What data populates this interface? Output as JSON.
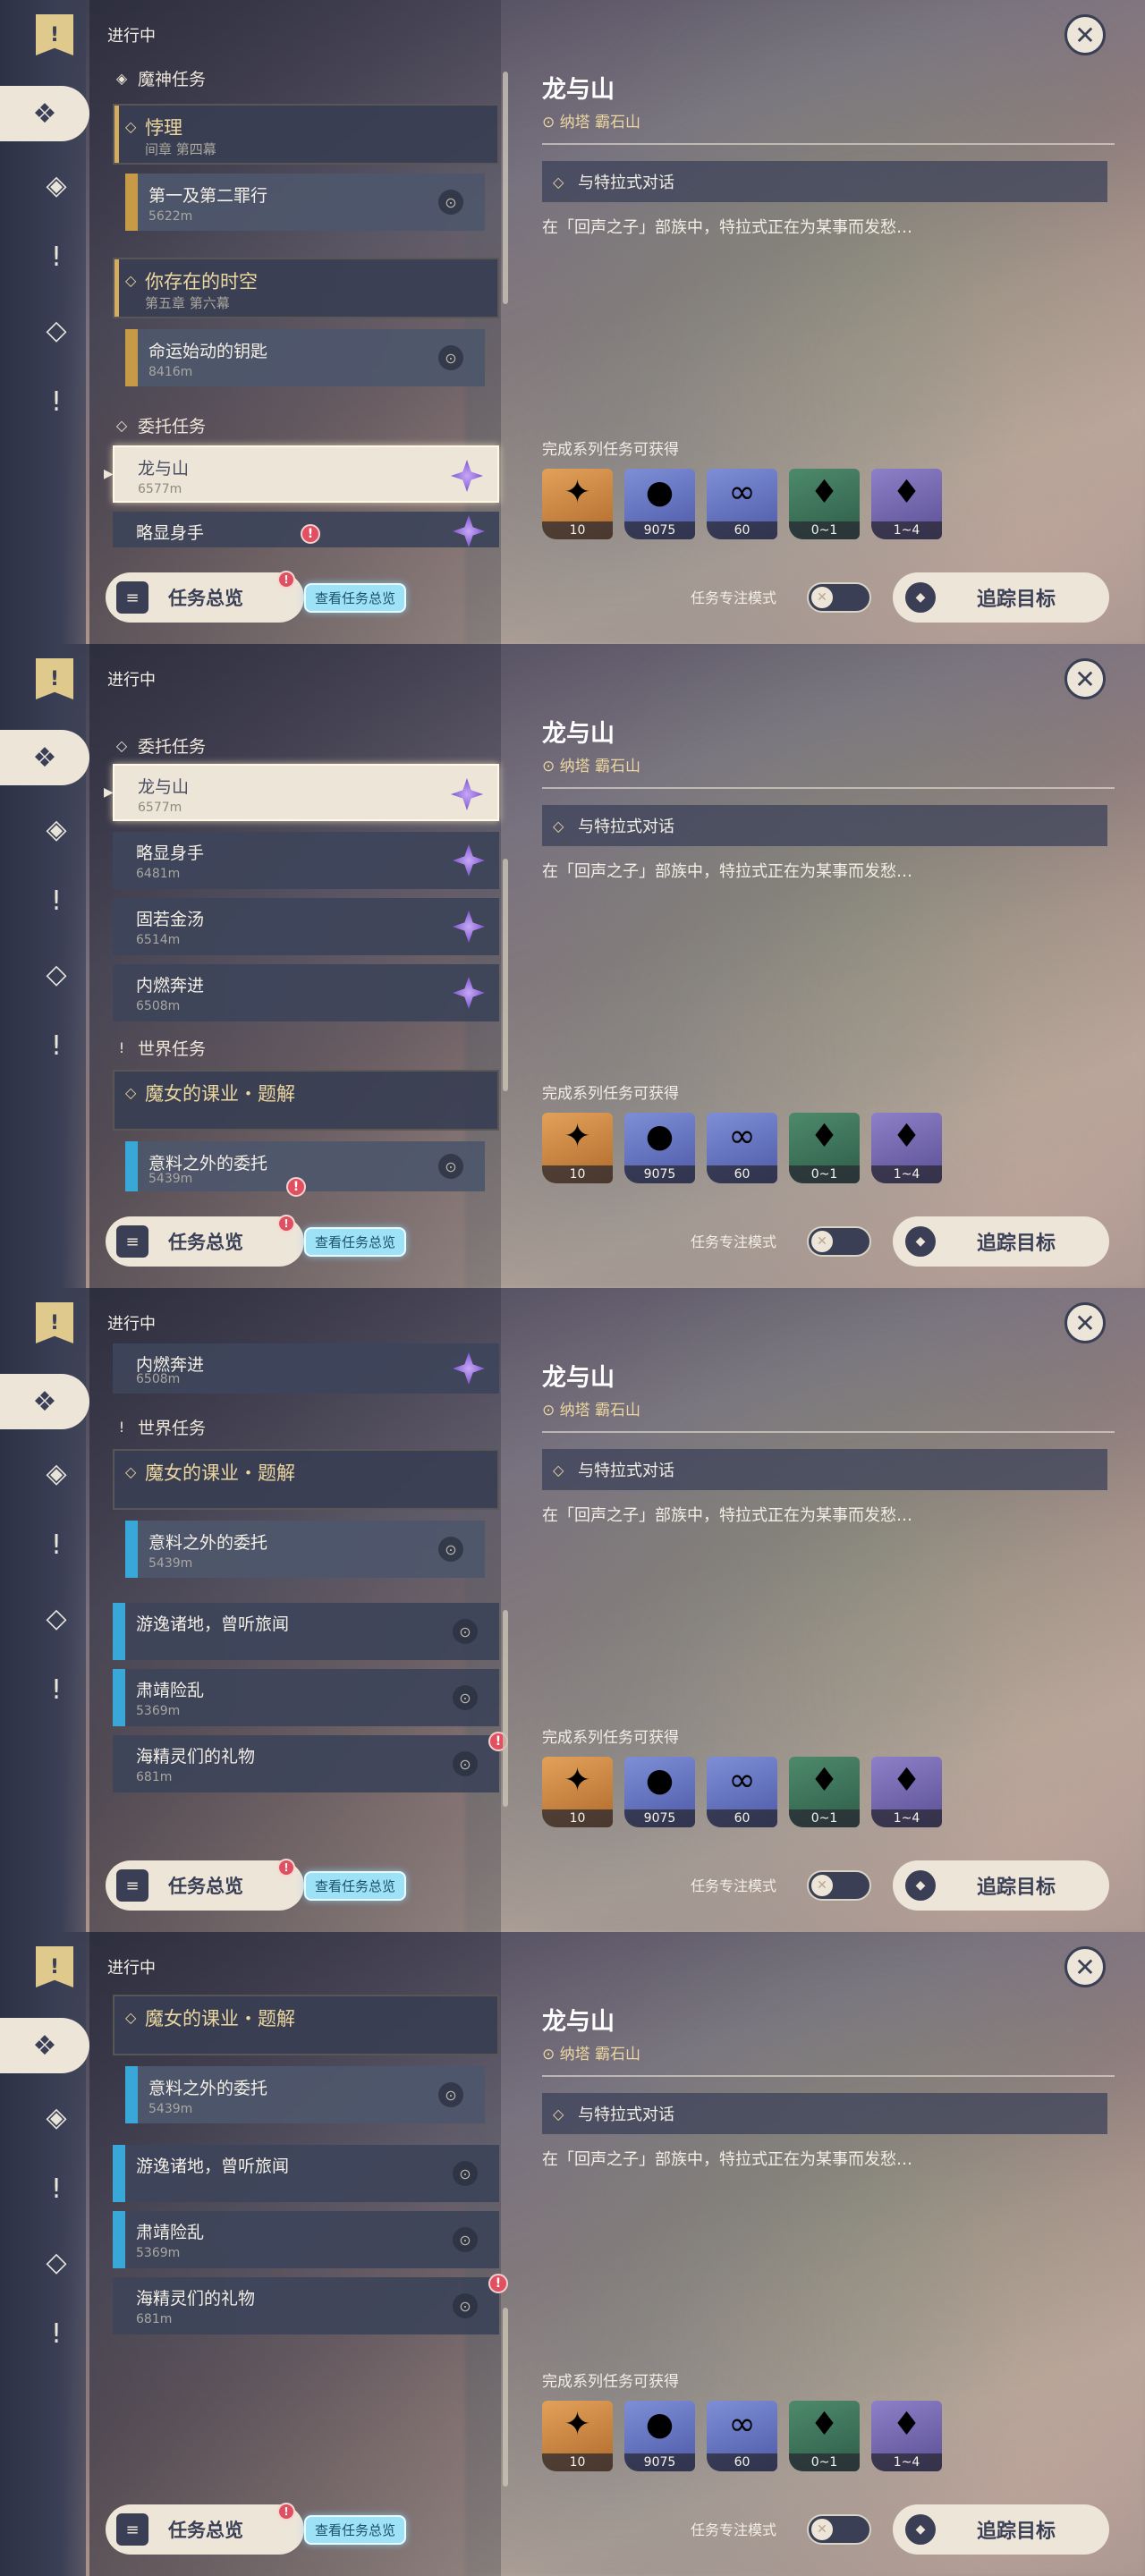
{
  "status_label": "进行中",
  "sections": {
    "archon": "魔神任务",
    "commission": "委托任务",
    "world": "世界任务"
  },
  "archon_quests": [
    {
      "title": "悖理",
      "chapter": "间章 第四幕",
      "sub_title": "第一及第二罪行",
      "sub_distance": "5622m"
    },
    {
      "title": "你存在的时空",
      "chapter": "第五章 第六幕",
      "sub_title": "命运始动的钥匙",
      "sub_distance": "8416m"
    }
  ],
  "commissions": [
    {
      "title": "龙与山",
      "distance": "6577m"
    },
    {
      "title": "略显身手",
      "distance": "6481m"
    },
    {
      "title": "固若金汤",
      "distance": "6514m"
    },
    {
      "title": "内燃奔进",
      "distance": "6508m"
    }
  ],
  "world_quest": {
    "title": "魔女的课业・题解",
    "sub_title": "意料之外的委托",
    "sub_distance": "5439m",
    "items": [
      {
        "title": "游逸诸地，曾听旅闻",
        "distance": ""
      },
      {
        "title": "肃靖险乱",
        "distance": "5369m"
      },
      {
        "title": "海精灵们的礼物",
        "distance": "681m"
      }
    ]
  },
  "overview": {
    "label": "任务总览",
    "hint": "查看任务总览",
    "badge": "!"
  },
  "detail": {
    "title": "龙与山",
    "location": "纳塔 霸石山",
    "objective": "与特拉式对话",
    "description": "在「回声之子」部族中，特拉式正在为某事而发愁…",
    "reward_label": "完成系列任务可获得",
    "rewards": [
      {
        "icon": "primogem-icon",
        "count": "10"
      },
      {
        "icon": "mora-icon",
        "count": "9075"
      },
      {
        "icon": "exp-icon",
        "count": "60"
      },
      {
        "icon": "crystal-icon",
        "count": "0~1"
      },
      {
        "icon": "crystal-cluster-icon",
        "count": "1~4"
      }
    ],
    "focus_label": "任务专注模式",
    "track_label": "追踪目标"
  },
  "colors": {
    "gold": "#ecd79f",
    "panel": "#3a3f55",
    "cream": "#ece5d8",
    "alert": "#e05060",
    "blue_bar": "#39a8d8"
  }
}
